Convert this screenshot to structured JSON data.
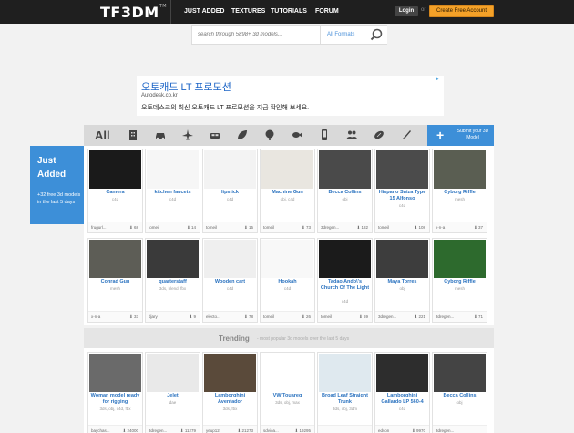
{
  "header": {
    "logo": "TF3DM",
    "logo_tm": "TM",
    "nav": [
      "JUST ADDED",
      "TEXTURES",
      "TUTORIALS",
      "FORUM"
    ],
    "login": "Login",
    "or": "or",
    "create": "Create Free Account"
  },
  "search": {
    "placeholder": "search through 5898+ 3d models...",
    "formats": "All Formats"
  },
  "ad": {
    "title": "오토캐드 LT 프로모션",
    "url": "Autodesk.co.kr",
    "desc": "오토데스크의 최신 오토캐드 LT 프로모션을 지금 확인해 보세요."
  },
  "categories": {
    "all_label": "All",
    "icons": [
      "building-icon",
      "car-icon",
      "airplane-icon",
      "vehicle-icon",
      "leaf-icon",
      "tree-icon",
      "fish-icon",
      "phone-icon",
      "people-icon",
      "sports-icon",
      "misc-icon"
    ],
    "submit": "Submit your 3D Model"
  },
  "just_added": {
    "title": "Just Added",
    "subtitle": "+32 free 3d models in the last 5 days"
  },
  "trending": {
    "title": "Trending",
    "subtitle": "- most popular 3d models over the last 5 days"
  },
  "row1": [
    {
      "name": "Camera",
      "fmt": "c4d",
      "user": "frugurl...",
      "dl": "68",
      "thumb": "#1a1a1a"
    },
    {
      "name": "kitchen faucets",
      "fmt": "c4d",
      "user": "tomeil",
      "dl": "14",
      "thumb": "#f6f6f6"
    },
    {
      "name": "lipstick",
      "fmt": "c4d",
      "user": "tomeil",
      "dl": "15",
      "thumb": "#f3f3f3"
    },
    {
      "name": "Machine Gun",
      "fmt": "obj, c4d",
      "user": "tomeil",
      "dl": "73",
      "thumb": "#e9e6e0"
    },
    {
      "name": "Becca Collins",
      "fmt": "obj",
      "user": "3dregen...",
      "dl": "182",
      "thumb": "#4a4a4a"
    },
    {
      "name": "Hispano Suiza Type 15 Alfonso",
      "fmt": "c4d",
      "user": "tomeil",
      "dl": "108",
      "thumb": "#4b4b4b"
    },
    {
      "name": "Cyborg Riffle",
      "fmt": "mesh",
      "user": "x-n-a",
      "dl": "37",
      "thumb": "#5a5e52"
    }
  ],
  "row2": [
    {
      "name": "Conrad Gun",
      "fmt": "mesh",
      "user": "x-n-a",
      "dl": "33",
      "thumb": "#5d5d56"
    },
    {
      "name": "quarterstaff",
      "fmt": "3ds, blend, fbx",
      "user": "djary",
      "dl": "9",
      "thumb": "#3a3a3a"
    },
    {
      "name": "Wooden cart",
      "fmt": "c4d",
      "user": "electo...",
      "dl": "78",
      "thumb": "#efefef"
    },
    {
      "name": "Hookah",
      "fmt": "c4d",
      "user": "tomeil",
      "dl": "26",
      "thumb": "#f8f8f8"
    },
    {
      "name": "Tadao Ando\\'s Church Of The Light",
      "fmt": "c4d",
      "user": "tomeil",
      "dl": "69",
      "thumb": "#1b1b1b"
    },
    {
      "name": "Maya Torres",
      "fmt": "obj",
      "user": "3dregen...",
      "dl": "221",
      "thumb": "#3d3d3d"
    },
    {
      "name": "Cyborg Riffle",
      "fmt": "mesh",
      "user": "3dregen...",
      "dl": "71",
      "thumb": "#2d6a2d"
    }
  ],
  "row3": [
    {
      "name": "Woman model ready for rigging",
      "fmt": "3ds, obj, c4d, fbx",
      "user": "baychas...",
      "dl": "24000",
      "thumb": "#6a6a6a"
    },
    {
      "name": "Jelet",
      "fmt": "dae",
      "user": "3dregen...",
      "dl": "11279",
      "thumb": "#e9e9e9"
    },
    {
      "name": "Lamborghini Aventador",
      "fmt": "3ds, fbx",
      "user": "yeup12",
      "dl": "21273",
      "thumb": "#5a4a3a"
    },
    {
      "name": "VW Touareg",
      "fmt": "3ds, obj, max",
      "user": "sdvioa...",
      "dl": "19295",
      "thumb": "#ffffff"
    },
    {
      "name": "Broad Leaf Straight Trunk",
      "fmt": "3ds, obj, 3dm",
      "user": "",
      "dl": "",
      "thumb": "#dfe9ef"
    },
    {
      "name": "Lamborghini Gallardo LP 560-4",
      "fmt": "c4d",
      "user": "edson",
      "dl": "9970",
      "thumb": "#2d2d2d"
    },
    {
      "name": "Becca Collins",
      "fmt": "obj",
      "user": "3dregen...",
      "dl": "",
      "thumb": "#444"
    }
  ]
}
